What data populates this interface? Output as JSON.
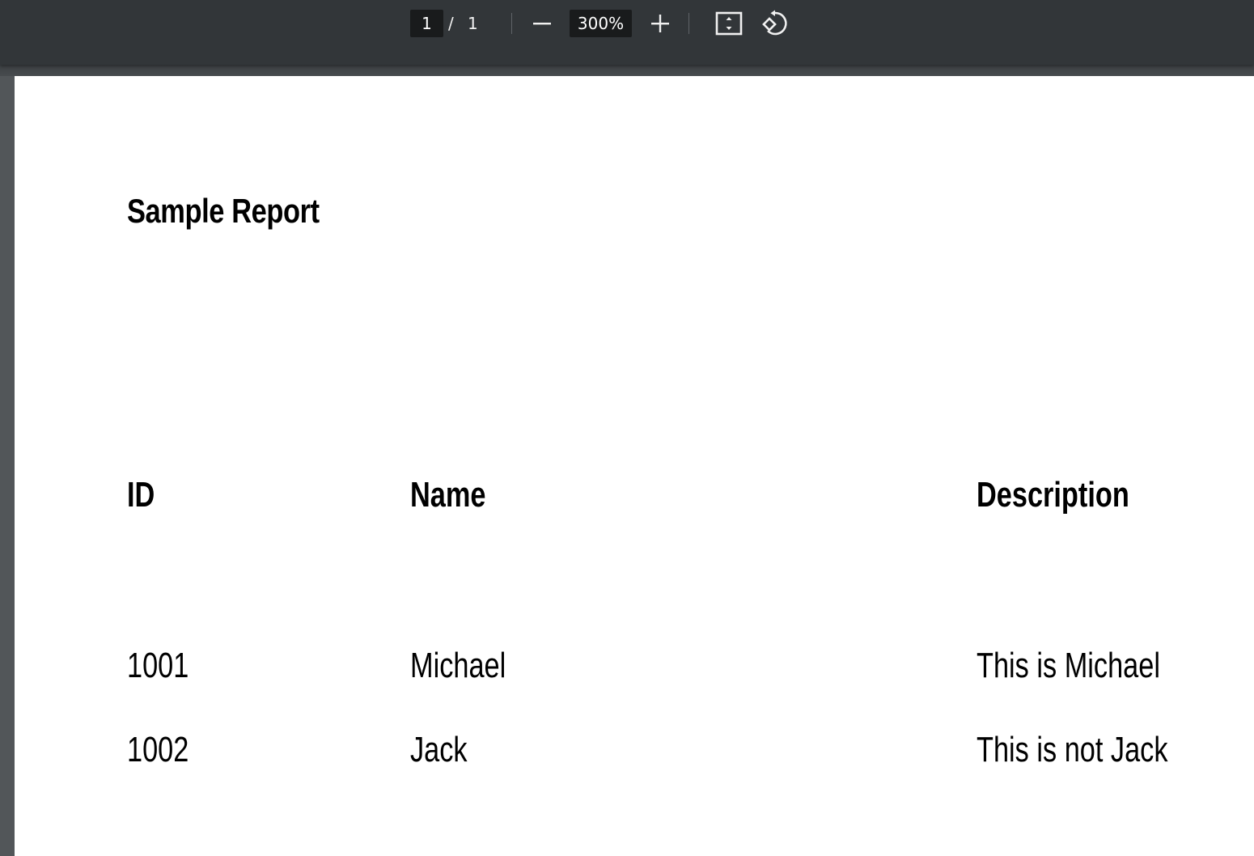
{
  "toolbar": {
    "current_page": "1",
    "page_separator": "/",
    "total_pages": "1",
    "zoom_level": "300%",
    "icons": {
      "zoom_out": "minus-icon",
      "zoom_in": "plus-icon",
      "fit_page": "fit-to-page-icon",
      "rotate": "rotate-counterclockwise-icon"
    },
    "colors": {
      "background": "#323639",
      "input_background": "#191b1c",
      "text": "#f1f1f1"
    }
  },
  "document": {
    "title": "Sample Report",
    "table": {
      "headers": [
        "ID",
        "Name",
        "Description"
      ],
      "rows": [
        [
          "1001",
          "Michael",
          "This is Michael"
        ],
        [
          "1002",
          "Jack",
          "This is not Jack"
        ]
      ]
    }
  },
  "colors": {
    "viewer_background": "#525659",
    "page_background": "#ffffff",
    "text": "#000000"
  }
}
